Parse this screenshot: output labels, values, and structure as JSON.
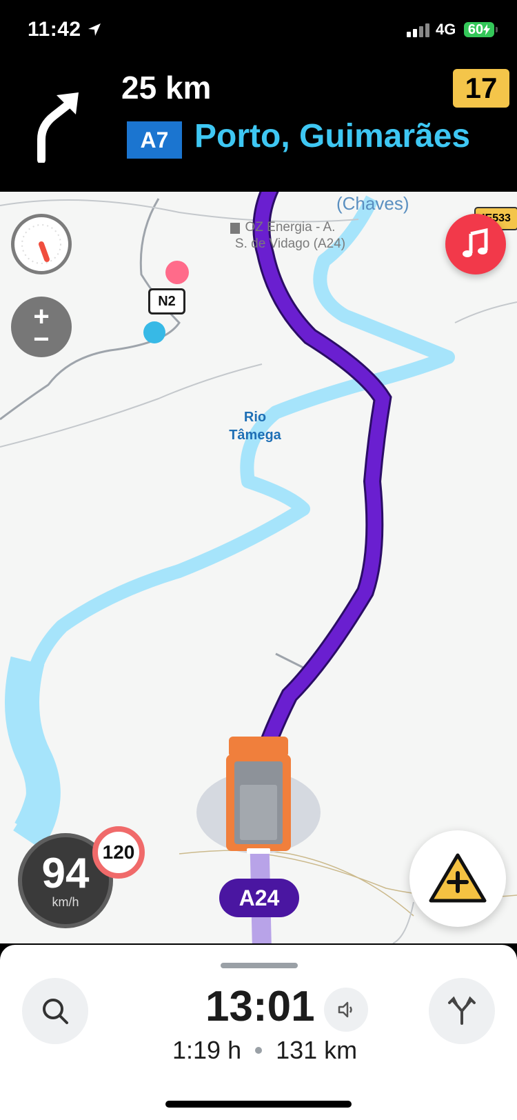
{
  "status_bar": {
    "time": "11:42",
    "network": "4G",
    "battery": "60"
  },
  "nav": {
    "distance": "25 km",
    "road": "A7",
    "destination": "Porto, Guimarães",
    "exit": "17"
  },
  "map": {
    "city": "(Chaves)",
    "poi": [
      "OZ Energia - A.",
      "S. de Vidago (A24)"
    ],
    "river": [
      "Rio",
      "Tâmega"
    ],
    "road_n2": "N2",
    "road_ie533": "IE533",
    "current_road": "A24"
  },
  "speed": {
    "value": "94",
    "unit": "km/h",
    "limit": "120"
  },
  "bottom": {
    "eta": "13:01",
    "duration": "1:19 h",
    "distance": "131 km"
  },
  "colors": {
    "route": "#6a1fd0",
    "river": "#a6e4fb",
    "accent": "#3ec7f3"
  }
}
